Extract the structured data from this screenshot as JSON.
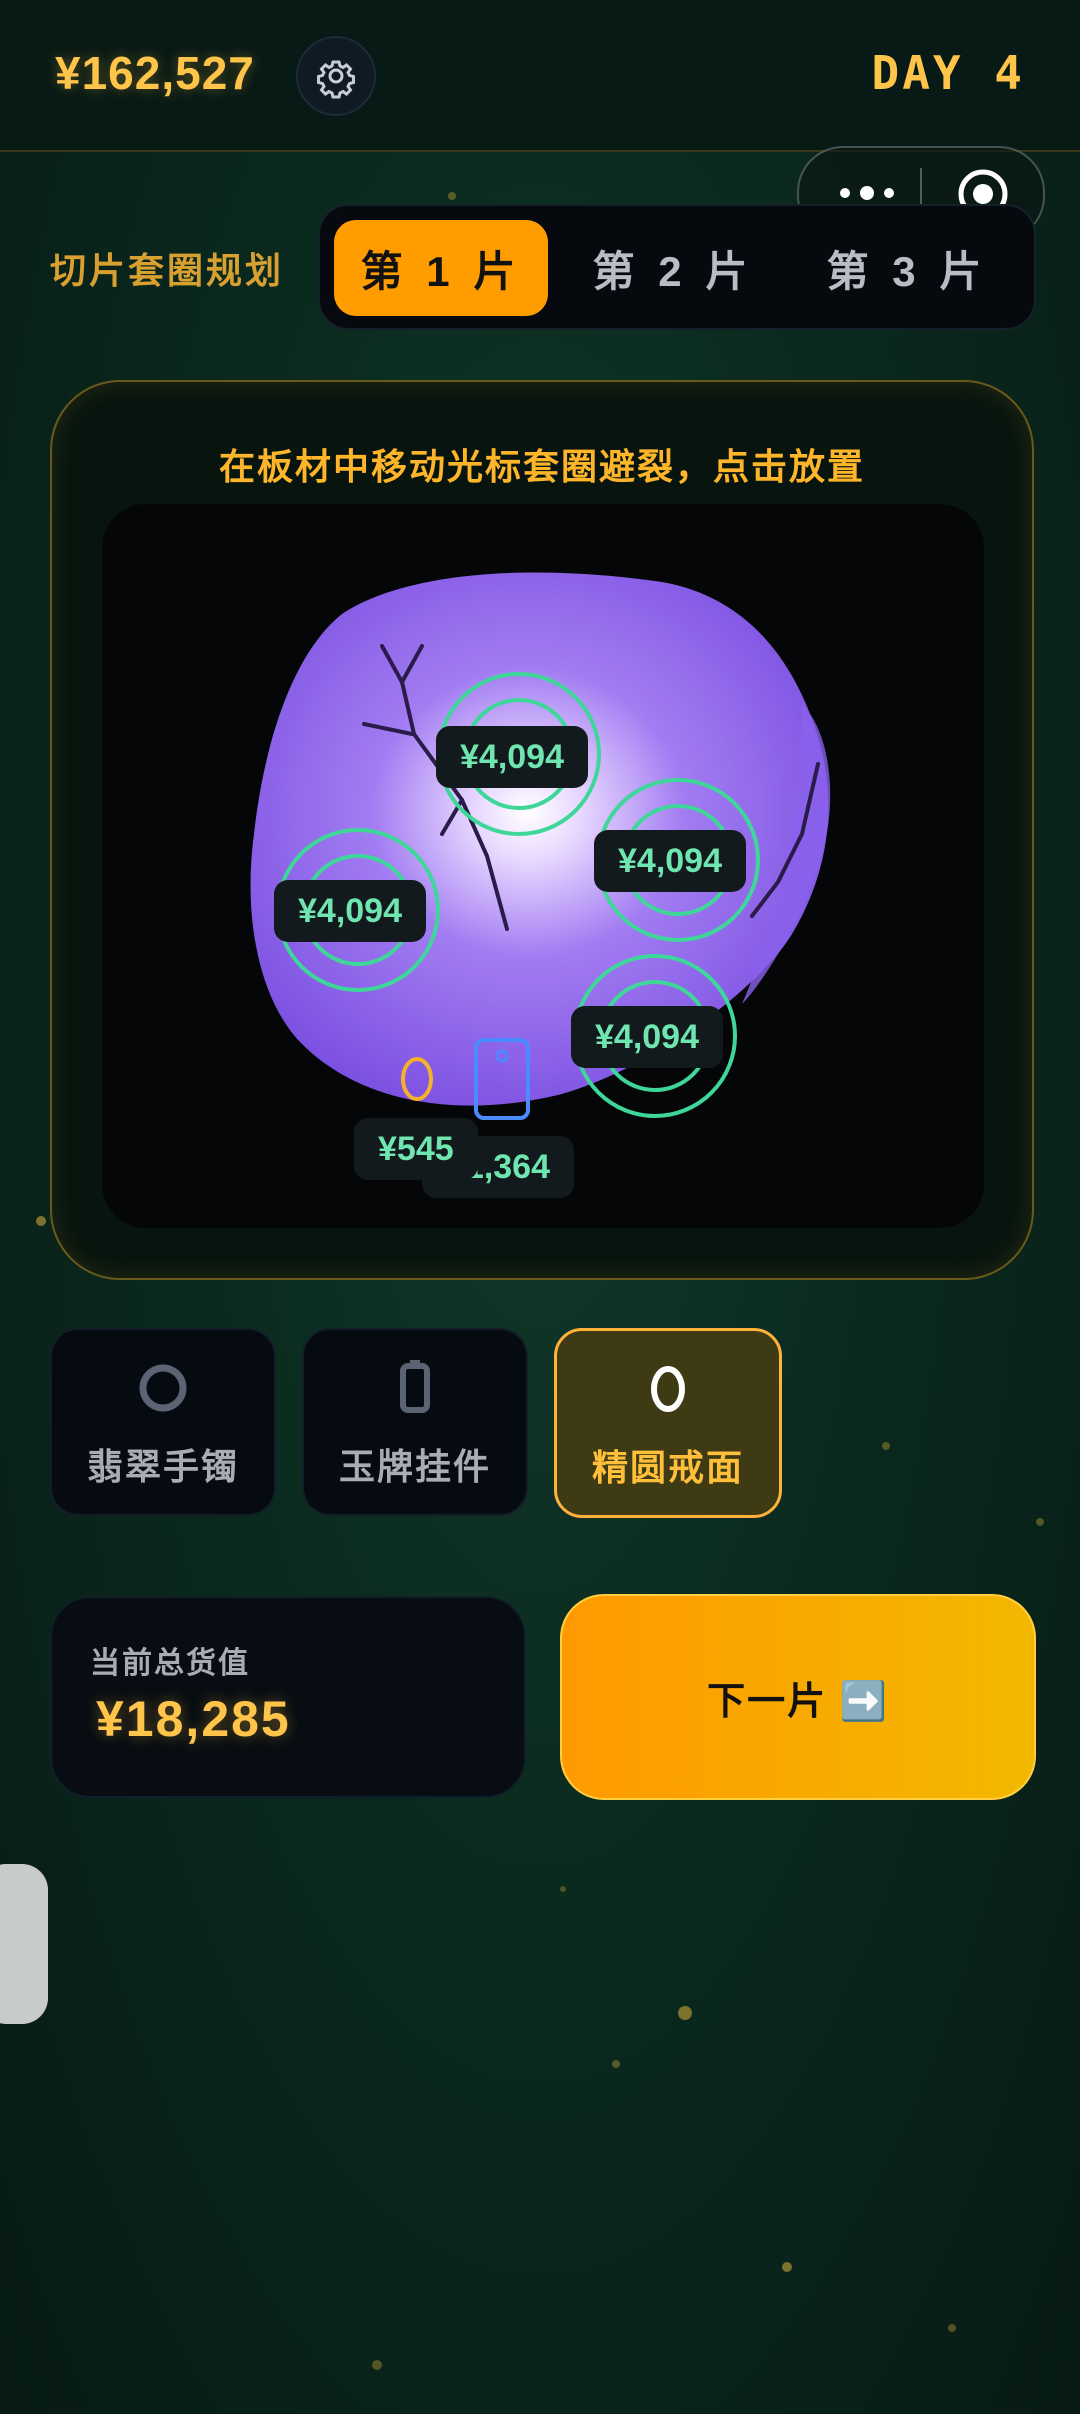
{
  "header": {
    "money": "¥162,527",
    "settings_icon": "gear-icon",
    "day": "DAY 4"
  },
  "capsule": {
    "more_icon": "more-dots-icon",
    "close_icon": "target-close-icon"
  },
  "plan": {
    "label": "切片套圈规划",
    "tabs": [
      {
        "label": "第 1 片",
        "active": true
      },
      {
        "label": "第 2 片",
        "active": false
      },
      {
        "label": "第 3 片",
        "active": false
      }
    ]
  },
  "board": {
    "instruction": "在板材中移动光标套圈避裂，点击放置",
    "placements": [
      {
        "type": "bangle",
        "price": "¥4,094"
      },
      {
        "type": "bangle",
        "price": "¥4,094"
      },
      {
        "type": "bangle",
        "price": "¥4,094"
      },
      {
        "type": "bangle",
        "price": "¥4,094"
      },
      {
        "type": "ring",
        "price": "¥545"
      },
      {
        "type": "pendant",
        "price": "¥1,364"
      }
    ],
    "colors": {
      "stone": "#8a5ef0",
      "bangle": "#3fd69a",
      "ring": "#f5b12a",
      "pendant": "#4a8cff"
    }
  },
  "products": [
    {
      "label": "翡翠手镯",
      "icon": "bangle-icon",
      "active": false
    },
    {
      "label": "玉牌挂件",
      "icon": "pendant-icon",
      "active": false
    },
    {
      "label": "精圆戒面",
      "icon": "ring-icon",
      "active": true
    }
  ],
  "summary": {
    "value_label": "当前总货值",
    "value": "¥18,285",
    "next_button": "下一片 ➡️"
  },
  "colors": {
    "accent": "#ff9d00",
    "gold": "#ffc44a",
    "green": "#6fe6b0"
  }
}
